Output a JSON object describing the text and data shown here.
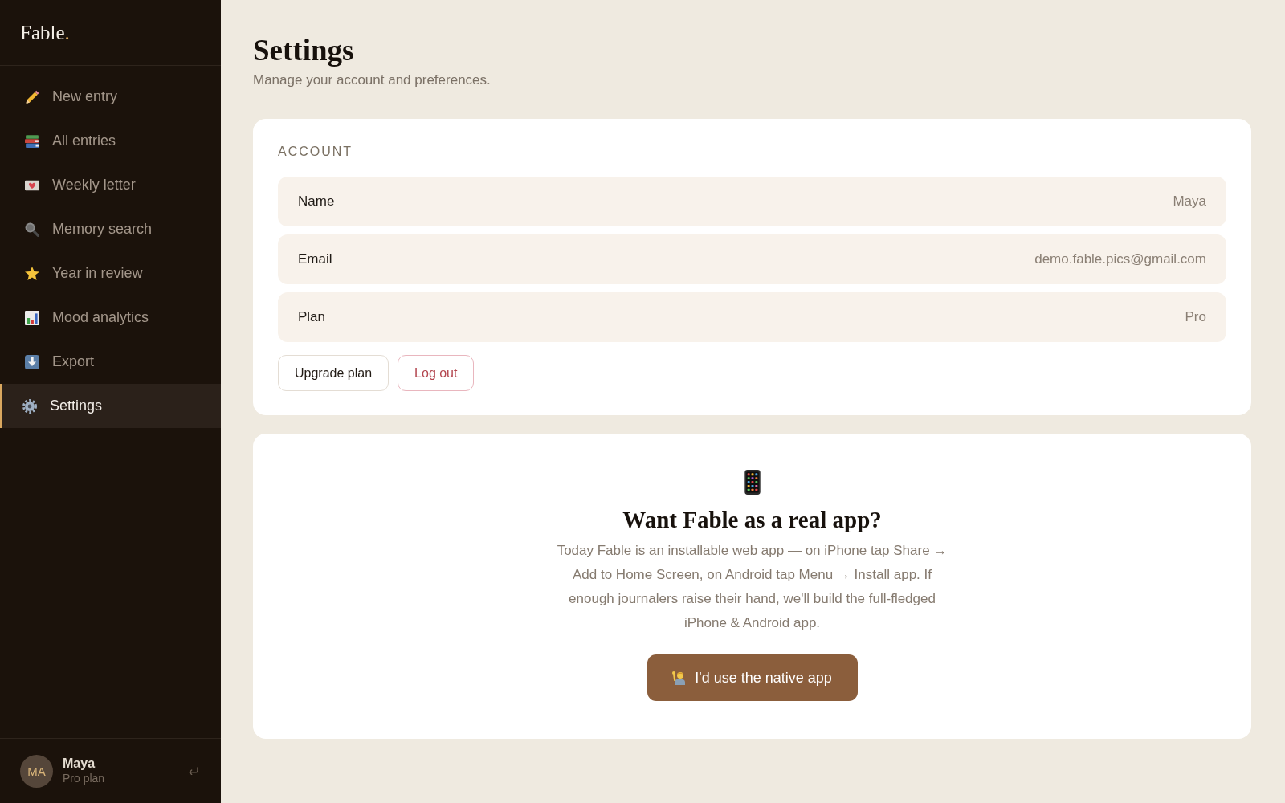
{
  "sidebar": {
    "logo": {
      "text": "Fable",
      "accent": "."
    },
    "items": [
      {
        "label": "New entry",
        "selected": false
      },
      {
        "label": "All entries",
        "selected": false
      },
      {
        "label": "Weekly letter",
        "selected": false
      },
      {
        "label": "Memory search",
        "selected": false
      },
      {
        "label": "Year in review",
        "selected": false
      },
      {
        "label": "Mood analytics",
        "selected": false
      },
      {
        "label": "Export",
        "selected": false
      },
      {
        "label": "Settings",
        "selected": true
      }
    ],
    "user": {
      "initials": "MA",
      "name": "Maya",
      "plan": "Pro plan"
    }
  },
  "header": {
    "title": "Settings",
    "subtitle": "Manage your account and preferences."
  },
  "account": {
    "heading": "ACCOUNT",
    "fields": [
      {
        "label": "Name",
        "value": "Maya"
      },
      {
        "label": "Email",
        "value": "demo.fable.pics@gmail.com"
      },
      {
        "label": "Plan",
        "value": "Pro"
      }
    ],
    "buttons": [
      {
        "label": "Upgrade plan",
        "kind": "default"
      },
      {
        "label": "Log out",
        "kind": "danger"
      }
    ]
  },
  "promo": {
    "title": "Want Fable as a real app?",
    "text": "Today Fable is an installable web app — on iPhone tap Share → Add to Home Screen, on Android tap Menu → Install app. If enough journalers raise their hand, we'll build the full-fledged iPhone & Android app.",
    "button": "I'd use the native app"
  }
}
